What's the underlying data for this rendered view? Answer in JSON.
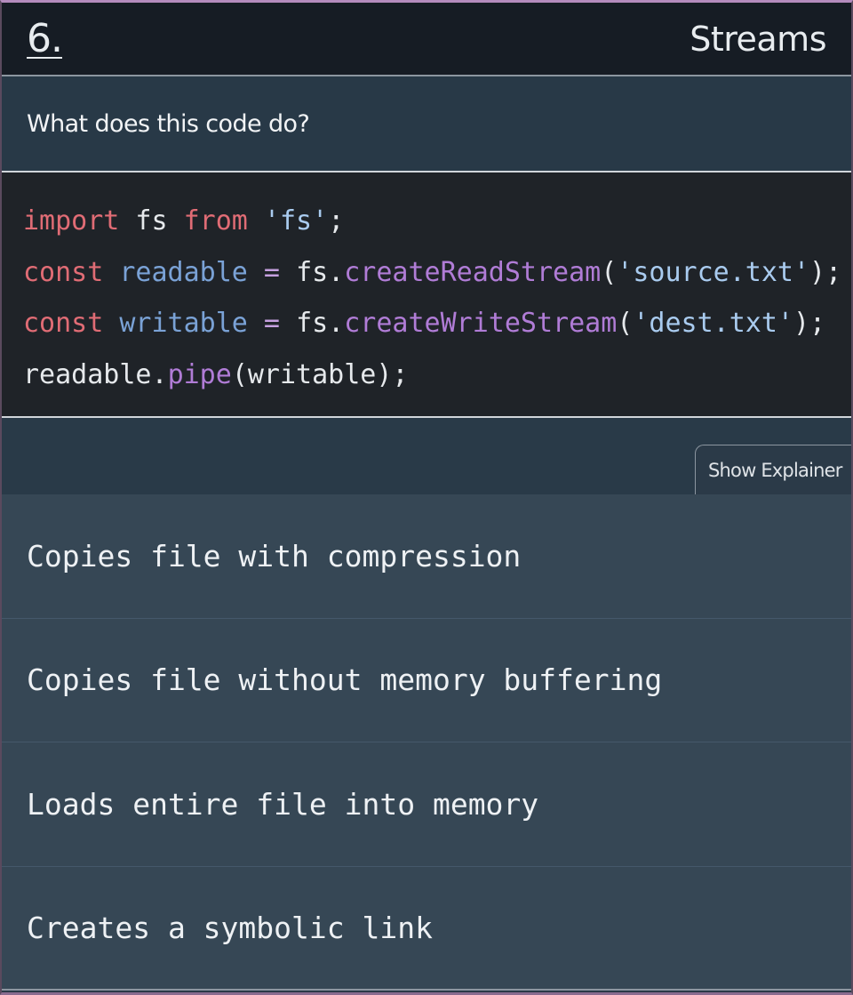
{
  "question": {
    "number": "6.",
    "topic": "Streams",
    "prompt": "What does this code do?"
  },
  "code": {
    "line1": {
      "t1": "import",
      "t2": " fs ",
      "t3": "from",
      "t4": " ",
      "t5": "'fs'",
      "t6": ";"
    },
    "line2": {
      "t1": "const",
      "t2": " ",
      "t3": "readable",
      "t4": " = ",
      "t5": "fs.",
      "t6": "createReadStream",
      "t7": "(",
      "t8": "'source.txt'",
      "t9": ");"
    },
    "line3": {
      "t1": "const",
      "t2": " ",
      "t3": "writable",
      "t4": " = ",
      "t5": "fs.",
      "t6": "createWriteStream",
      "t7": "(",
      "t8": "'dest.txt'",
      "t9": ");"
    },
    "line4": {
      "t1": "readable.",
      "t2": "pipe",
      "t3": "(writable);"
    }
  },
  "explainer": {
    "button_label": "Show Explainer"
  },
  "options": [
    "Copies file with compression",
    "Copies file without memory buffering",
    "Loads entire file into memory",
    "Creates a symbolic link"
  ],
  "colors": {
    "keyword": "#e06c75",
    "variable": "#7aa2d6",
    "string": "#a9cbef",
    "function": "#b07cd6",
    "header_bg": "#161c24",
    "option_bg": "#364755"
  }
}
